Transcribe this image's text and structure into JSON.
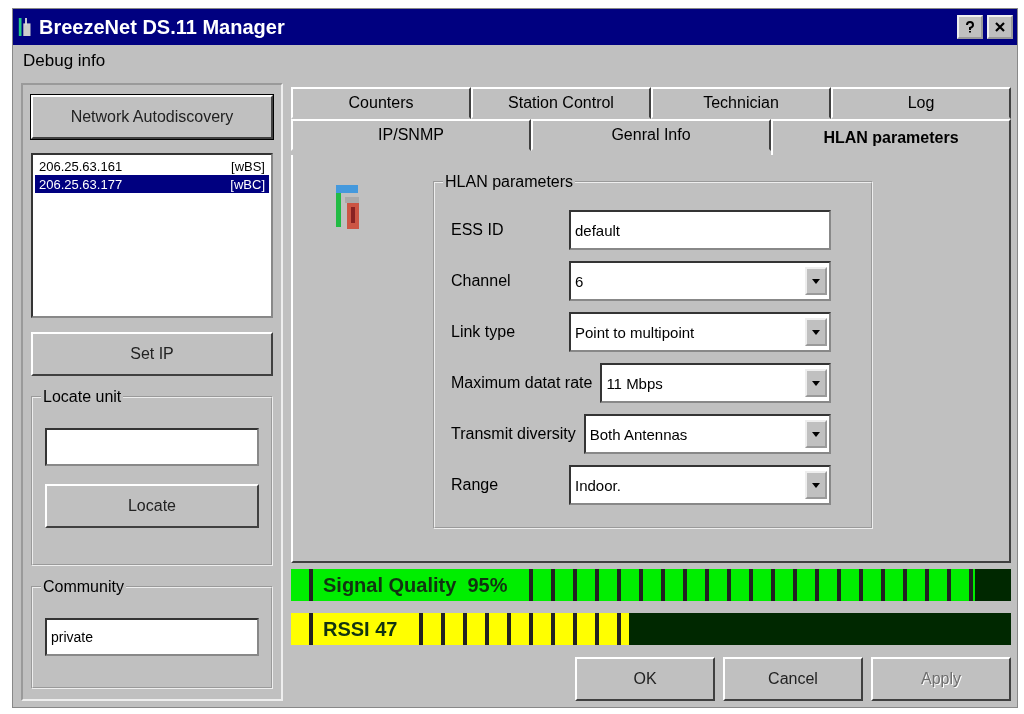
{
  "window": {
    "title": "BreezeNet DS.11 Manager"
  },
  "menu": [
    "Debug info"
  ],
  "sidebar": {
    "discover_button": "Network Autodiscovery",
    "units": [
      {
        "ip": "206.25.63.161",
        "type": "[wBS]",
        "selected": false
      },
      {
        "ip": "206.25.63.177",
        "type": "[wBC]",
        "selected": true
      }
    ],
    "set_ip_button": "Set IP",
    "locate": {
      "title": "Locate unit",
      "locate_button": "Locate"
    },
    "community": {
      "title": "Community",
      "value": "private"
    }
  },
  "tabs": [
    [
      {
        "label": "Counters",
        "selected": false
      },
      {
        "label": "Station Control",
        "selected": false
      },
      {
        "label": "Technician",
        "selected": false
      },
      {
        "label": "Log",
        "selected": false
      }
    ],
    [
      {
        "label": "IP/SNMP",
        "selected": false
      },
      {
        "label": "Genral Info",
        "selected": false
      },
      {
        "label": "HLAN parameters",
        "selected": true
      }
    ]
  ],
  "group": {
    "title": "HLAN parameters",
    "fields": [
      {
        "label": "ESS ID",
        "kind": "text",
        "value": "default"
      },
      {
        "label": "Channel",
        "kind": "dropdown",
        "value": "6"
      },
      {
        "label": "Link type",
        "kind": "dropdown",
        "value": "Point to multipoint"
      },
      {
        "label": "Maximum datat rate",
        "kind": "dropdown",
        "value": "11 Mbps"
      },
      {
        "label": "Transmit diversity",
        "kind": "dropdown",
        "value": "Both Antennas"
      },
      {
        "label": "Range",
        "kind": "dropdown",
        "value": "Indoor."
      }
    ]
  },
  "meters": [
    {
      "label": "Signal Quality  95%",
      "color": "#00ee00",
      "level": 0.95
    },
    {
      "label": "RSSI 47",
      "color": "#ffff00",
      "level": 0.47
    }
  ],
  "buttons": [
    {
      "label": "OK",
      "disabled": false
    },
    {
      "label": "Cancel",
      "disabled": false
    },
    {
      "label": "Apply",
      "disabled": true
    }
  ]
}
